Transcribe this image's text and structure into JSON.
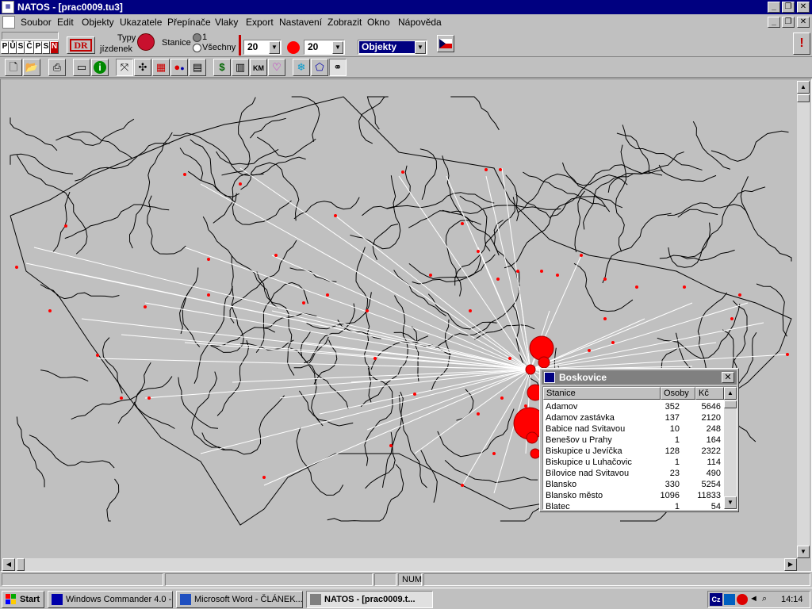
{
  "window": {
    "title": "NATOS - [prac0009.tu3]",
    "minimize": "_",
    "maximize": "❐",
    "close": "✕"
  },
  "menu": {
    "items": [
      "Soubor",
      "Edit",
      "Objekty",
      "Ukazatele",
      "Přepínače",
      "Vlaky",
      "Export",
      "Nastavení",
      "Zobrazit",
      "Okno",
      "Nápověda"
    ]
  },
  "toolbar1": {
    "logo_letters": [
      "P",
      "Ů",
      "S",
      "Č",
      "P",
      "S",
      "N"
    ],
    "dr_label": "DR",
    "typy_label": "Typy",
    "jizdenek_label": "jízdenek",
    "stanice_label": "Stanice",
    "radio_one_label": "1",
    "radio_all_label": "Všechny",
    "value_1": "20",
    "value_2": "20",
    "objekty_label": "Objekty",
    "alert_label": "!"
  },
  "map": {
    "accent_red": "#ff0000",
    "line_color": "#000000",
    "ray_color": "#ffffff"
  },
  "popup": {
    "title": "Boskovice",
    "close": "✕",
    "columns": {
      "station": "Stanice",
      "persons": "Osoby",
      "czk": "Kč"
    },
    "rows": [
      {
        "station": "Adamov",
        "persons": "352",
        "czk": "5646"
      },
      {
        "station": "Adamov zastávka",
        "persons": "137",
        "czk": "2120"
      },
      {
        "station": "Babice nad Svitavou",
        "persons": "10",
        "czk": "248"
      },
      {
        "station": "Benešov u Prahy",
        "persons": "1",
        "czk": "164"
      },
      {
        "station": "Biskupice u Jevíčka",
        "persons": "128",
        "czk": "2322"
      },
      {
        "station": "Biskupice u Luhačovic",
        "persons": "1",
        "czk": "114"
      },
      {
        "station": "Bílovice nad Svitavou",
        "persons": "23",
        "czk": "490"
      },
      {
        "station": "Blansko",
        "persons": "330",
        "czk": "5254"
      },
      {
        "station": "Blansko město",
        "persons": "1096",
        "czk": "11833"
      },
      {
        "station": "Blatec",
        "persons": "1",
        "czk": "54"
      }
    ]
  },
  "statusbar": {
    "num_label": "NUM"
  },
  "taskbar": {
    "start_label": "Start",
    "tasks": [
      "Windows Commander 4.0 -...",
      "Microsoft Word - ČLÁNEK...",
      "NATOS - [prac0009.t..."
    ],
    "clock": "14:14",
    "lang": "Cz"
  }
}
